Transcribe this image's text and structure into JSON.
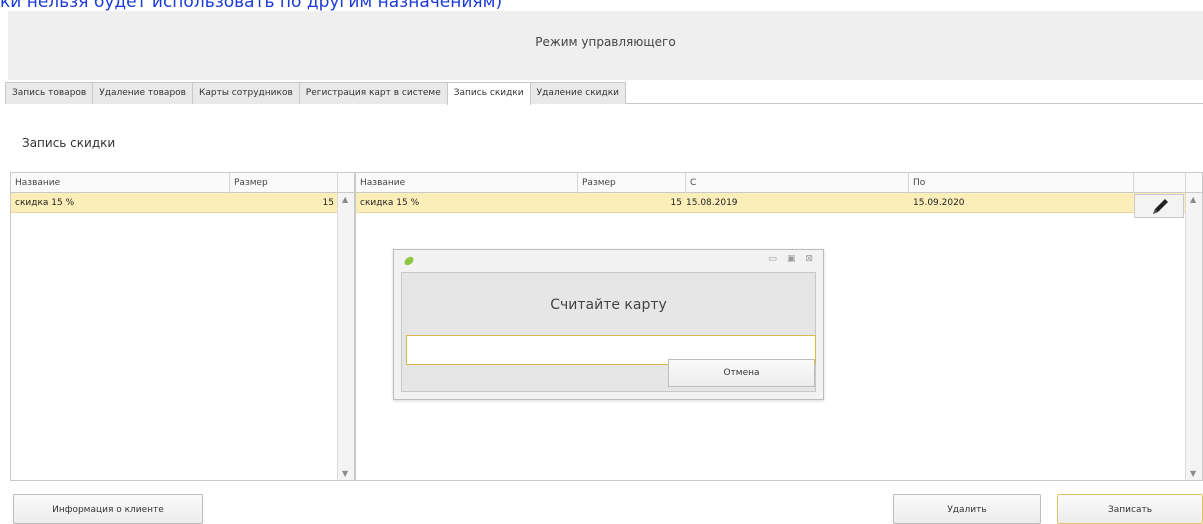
{
  "banner_text": "ки нельзя будет использовать по другим назначениям)",
  "window": {
    "title": "Режим управляющего"
  },
  "tabs": [
    {
      "label": "Запись товаров"
    },
    {
      "label": "Удаление товаров"
    },
    {
      "label": "Карты сотрудников"
    },
    {
      "label": "Регистрация карт в системе"
    },
    {
      "label": "Запись скидки",
      "active": true
    },
    {
      "label": "Удаление скидки"
    }
  ],
  "section_title": "Запись скидки",
  "left_grid": {
    "headers": {
      "name": "Название",
      "size": "Размер"
    },
    "rows": [
      {
        "name": "скидка 15 %",
        "size": "15"
      }
    ]
  },
  "right_grid": {
    "headers": {
      "name": "Название",
      "size": "Размер",
      "from": "С",
      "to": "По"
    },
    "rows": [
      {
        "name": "скидка 15 %",
        "size": "15",
        "from": "15.08.2019",
        "to": "15.09.2020"
      }
    ],
    "row_action_icon": "pencil-icon"
  },
  "dialog": {
    "heading": "Считайте карту",
    "input_value": "",
    "cancel_label": "Отмена",
    "app_icon": "leaf-icon",
    "controls": [
      "minimize-icon",
      "maximize-icon",
      "close-icon"
    ]
  },
  "buttons": {
    "client_info": "Информация о клиенте",
    "delete": "Удалить",
    "save": "Записать"
  },
  "colors": {
    "selected_row": "#fbeeb8",
    "banner_text": "#1a3bd6",
    "focus_border": "#d9b84a"
  }
}
